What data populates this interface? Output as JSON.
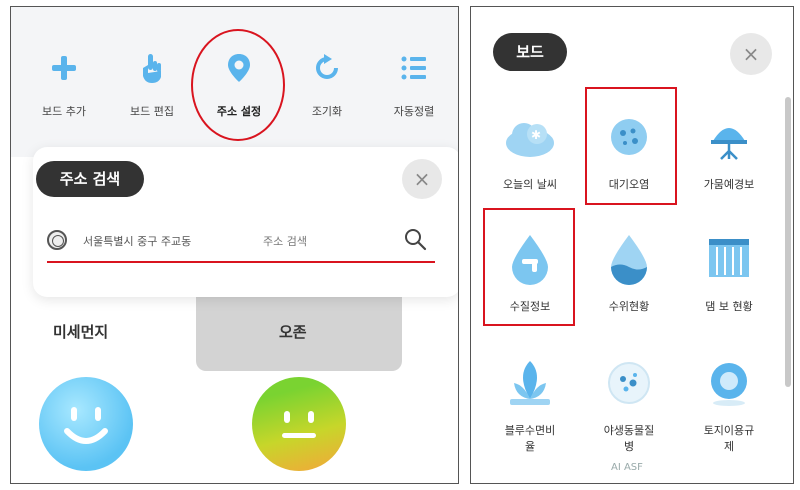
{
  "left_panel": {
    "toolbar": [
      {
        "label": "보드 추가",
        "icon": "plus-icon"
      },
      {
        "label": "보드 편집",
        "icon": "hand-pointer-icon"
      },
      {
        "label": "주소 설정",
        "icon": "location-pin-icon",
        "active": true
      },
      {
        "label": "조기화",
        "icon": "refresh-icon"
      },
      {
        "label": "자동정렬",
        "icon": "list-icon"
      }
    ],
    "address_search": {
      "title": "주소 검색",
      "close_symbol": "×",
      "address_value": "서울특별시 중구 주교동",
      "placeholder": "주소 검색"
    },
    "metrics": [
      {
        "title": "미세먼지",
        "face": "smile"
      },
      {
        "title": "오존",
        "face": "neutral"
      }
    ]
  },
  "right_panel": {
    "title": "보드",
    "close_symbol": "×",
    "items": [
      {
        "label": "오늘의 날씨",
        "icon": "weather-icon"
      },
      {
        "label": "대기오염",
        "icon": "air-pollution-icon",
        "highlighted": true
      },
      {
        "label": "가뭄예경보",
        "icon": "drought-icon"
      },
      {
        "label": "수질정보",
        "icon": "water-quality-icon",
        "highlighted": true
      },
      {
        "label": "수위현황",
        "icon": "water-level-icon"
      },
      {
        "label": "댐 보 현황",
        "icon": "dam-icon"
      },
      {
        "label": "블루수면비\n율",
        "icon": "sleep-ratio-icon"
      },
      {
        "label": "야생동물질\n병",
        "icon": "wildlife-disease-icon"
      },
      {
        "label": "토지이용규\n제",
        "icon": "land-use-icon"
      }
    ],
    "footer_text": "AI ASF"
  },
  "colors": {
    "accent_red": "#d9141f",
    "icon_blue": "#5ab4ec",
    "pill_dark": "#333333"
  }
}
